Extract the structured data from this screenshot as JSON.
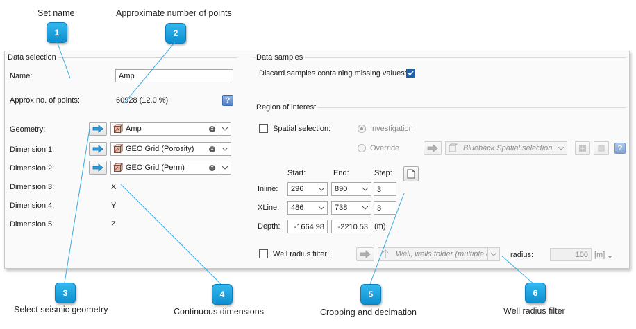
{
  "callouts": [
    {
      "num": "1",
      "label": "Set name"
    },
    {
      "num": "2",
      "label": "Approximate number of points"
    },
    {
      "num": "3",
      "label": "Select seismic geometry"
    },
    {
      "num": "4",
      "label": "Continuous dimensions"
    },
    {
      "num": "5",
      "label": "Cropping and decimation"
    },
    {
      "num": "6",
      "label": "Well radius filter"
    }
  ],
  "data_selection": {
    "title": "Data selection",
    "name_label": "Name:",
    "name_value": "Amp",
    "approx_label": "Approx no. of points:",
    "approx_value": "60928 (12.0 %)",
    "help_glyph": "?",
    "geometry_label": "Geometry:",
    "geometry_value": "Amp",
    "dim1_label": "Dimension 1:",
    "dim1_value": "GEO Grid (Porosity)",
    "dim2_label": "Dimension 2:",
    "dim2_value": "GEO Grid (Perm)",
    "dim3_label": "Dimension 3:",
    "dim3_value": "X",
    "dim4_label": "Dimension 4:",
    "dim4_value": "Y",
    "dim5_label": "Dimension 5:",
    "dim5_value": "Z"
  },
  "data_samples": {
    "title": "Data samples",
    "discard_label": "Discard samples containing missing values:",
    "discard_checked": true
  },
  "roi": {
    "title": "Region of interest",
    "spatial_label": "Spatial selection:",
    "investigation_label": "Investigation",
    "override_label": "Override",
    "spatial_combo": "Blueback Spatial selection",
    "start_label": "Start:",
    "end_label": "End:",
    "step_label": "Step:",
    "inline_label": "Inline:",
    "inline_start": "296",
    "inline_end": "890",
    "inline_step": "3",
    "xline_label": "XLine:",
    "xline_start": "486",
    "xline_end": "738",
    "xline_step": "3",
    "depth_label": "Depth:",
    "depth_start": "-1664.98",
    "depth_end": "-2210.53",
    "depth_unit": "(m)",
    "well_label": "Well radius filter:",
    "well_combo": "Well, wells folder (multiple or",
    "radius_label": "radius:",
    "radius_value": "100",
    "radius_unit": "[m]"
  },
  "colors": {
    "accent": "#1e5fb4",
    "badge": "#1a9fe0"
  }
}
